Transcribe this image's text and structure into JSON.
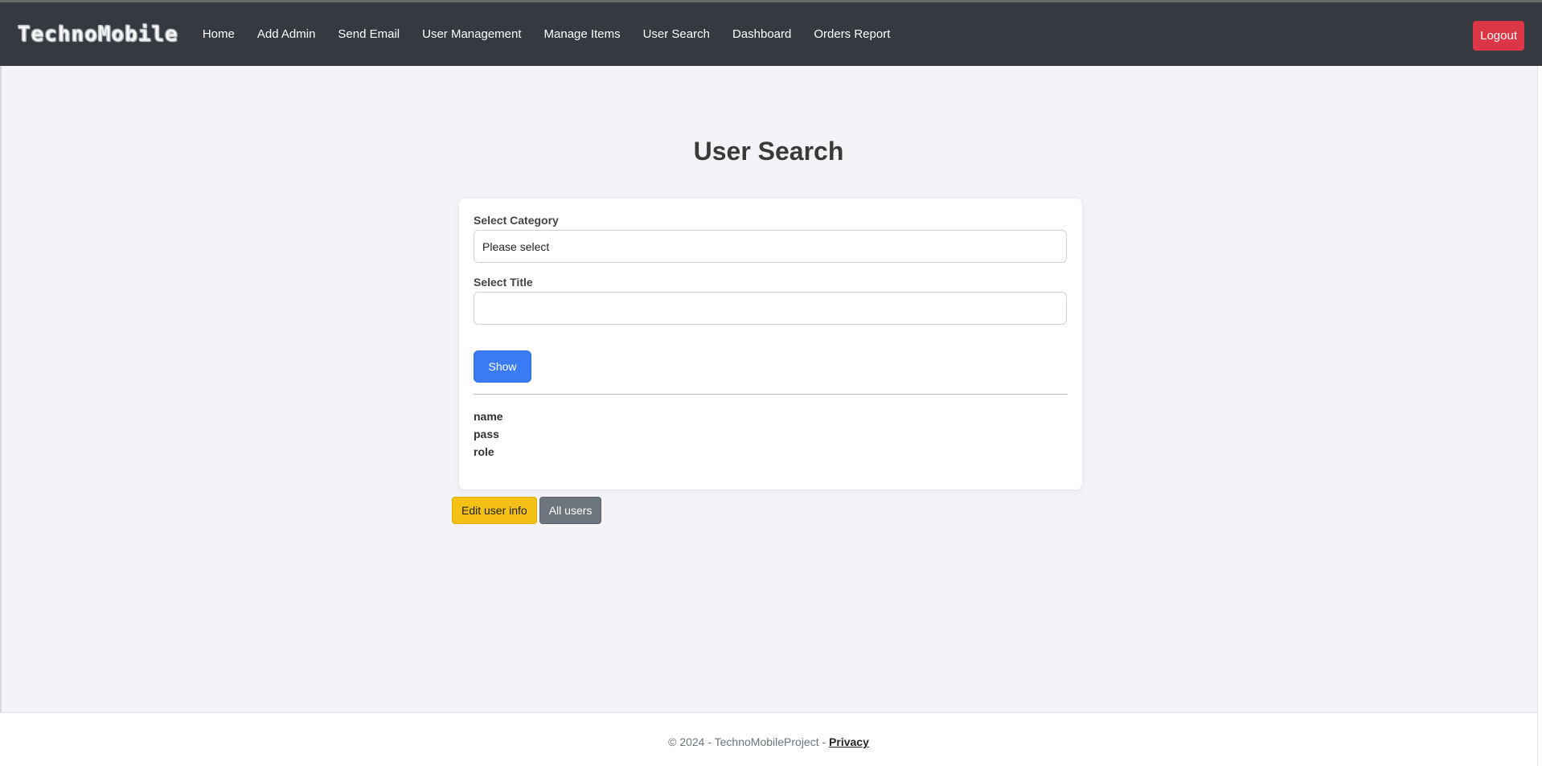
{
  "header": {
    "brand": "TechnoMobile",
    "nav": [
      {
        "label": "Home"
      },
      {
        "label": "Add Admin"
      },
      {
        "label": "Send Email"
      },
      {
        "label": "User Management"
      },
      {
        "label": "Manage Items"
      },
      {
        "label": "User Search"
      },
      {
        "label": "Dashboard"
      },
      {
        "label": "Orders Report"
      }
    ],
    "logout_label": "Logout"
  },
  "page": {
    "title": "User Search"
  },
  "form": {
    "category_label": "Select Category",
    "category_value": "Please select",
    "title_label": "Select Title",
    "title_value": "",
    "show_label": "Show"
  },
  "fields": [
    "name",
    "pass",
    "role"
  ],
  "actions": {
    "edit_label": "Edit user info",
    "all_users_label": "All users"
  },
  "footer": {
    "text": "© 2024 - TechnoMobileProject - ",
    "privacy_label": "Privacy"
  },
  "colors": {
    "navbar": "#343a40",
    "logout": "#dc3545",
    "primary": "#3b7cf6",
    "warning": "#f5c116",
    "secondary": "#6c757d"
  }
}
